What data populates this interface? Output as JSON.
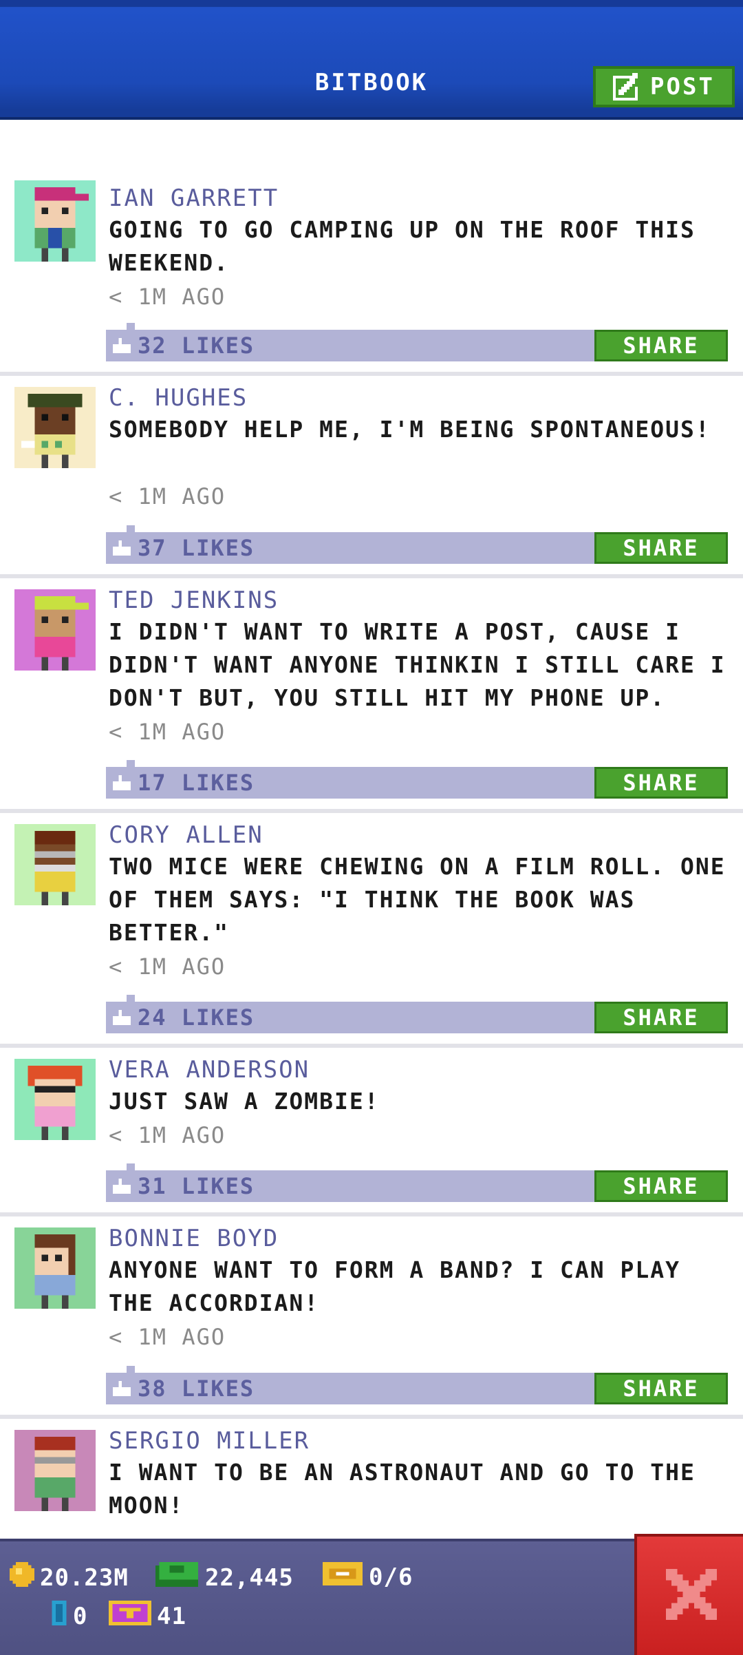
{
  "header": {
    "title": "BITBOOK",
    "post_label": "POST",
    "post_icon": "edit-icon"
  },
  "posts": [
    {
      "name": "IAN GARRETT",
      "text": "GOING TO GO CAMPING UP ON THE ROOF THIS WEEKEND.",
      "time": "< 1M AGO",
      "likes": "32 LIKES",
      "share": "SHARE",
      "avatar_bg": "#8ee8c8"
    },
    {
      "name": "C. HUGHES",
      "text": "SOMEBODY HELP ME, I'M BEING SPONTANEOUS!",
      "time": "< 1M AGO",
      "likes": "37 LIKES",
      "share": "SHARE",
      "avatar_bg": "#f8ecc8"
    },
    {
      "name": "TED JENKINS",
      "text": "I DIDN'T WANT TO WRITE A POST, CAUSE I DIDN'T WANT ANYONE THINKIN I STILL CARE I DON'T BUT, YOU STILL HIT MY PHONE UP.",
      "time": "< 1M AGO",
      "likes": "17 LIKES",
      "share": "SHARE",
      "avatar_bg": "#d478d8"
    },
    {
      "name": "CORY ALLEN",
      "text": "TWO MICE WERE CHEWING ON A FILM ROLL. ONE OF THEM SAYS: \"I THINK THE BOOK WAS BETTER.\"",
      "time": "< 1M AGO",
      "likes": "24 LIKES",
      "share": "SHARE",
      "avatar_bg": "#c4f2b4"
    },
    {
      "name": "VERA ANDERSON",
      "text": "JUST SAW A ZOMBIE!",
      "time": "< 1M AGO",
      "likes": "31 LIKES",
      "share": "SHARE",
      "avatar_bg": "#8ee8b8"
    },
    {
      "name": "BONNIE BOYD",
      "text": "ANYONE WANT TO FORM A BAND? I CAN PLAY THE ACCORDIAN!",
      "time": "< 1M AGO",
      "likes": "38 LIKES",
      "share": "SHARE",
      "avatar_bg": "#88d498"
    },
    {
      "name": "SERGIO MILLER",
      "text": "I WANT TO BE AN ASTRONAUT AND GO TO THE MOON!",
      "time": "< 1M AGO",
      "likes": "",
      "share": "",
      "avatar_bg": "#c888b8"
    }
  ],
  "status": {
    "coins": "20.23M",
    "bux": "22,445",
    "tickets": "0/6",
    "tower_bux": "0",
    "vip": "41",
    "coin_icon": "coin-icon",
    "bux_icon": "bux-icon",
    "ticket_icon": "ticket-icon",
    "tower_bux_icon": "tower-bux-icon",
    "vip_icon": "vip-icon"
  },
  "close_icon": "close-icon",
  "colors": {
    "header_blue": "#1c4ab8",
    "share_green": "#4aa22e",
    "like_bar": "#b2b3d6",
    "name_color": "#595c9c",
    "close_red": "#d92b2b"
  }
}
